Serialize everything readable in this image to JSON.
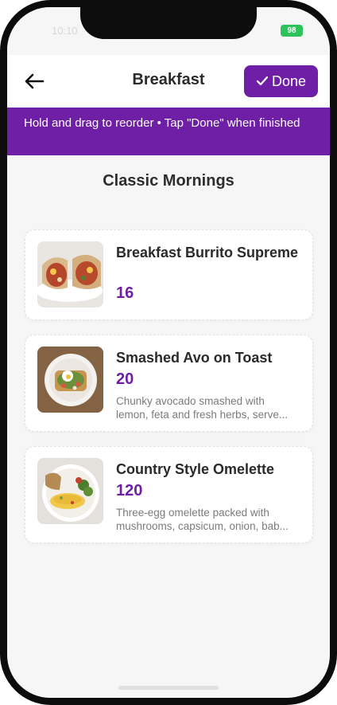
{
  "status_bar": {
    "time": "10:10",
    "battery": "98"
  },
  "header": {
    "title": "Breakfast",
    "done_label": "Done"
  },
  "banner": {
    "text": "Hold and drag to reorder • Tap \"Done\" when finished"
  },
  "section": {
    "title": "Classic Mornings"
  },
  "items": [
    {
      "title": "Breakfast Burrito Supreme",
      "count": "16",
      "description": []
    },
    {
      "title": "Smashed Avo on Toast",
      "count": "20",
      "description": [
        "Chunky avocado smashed with",
        "lemon, feta and fresh herbs, serve..."
      ]
    },
    {
      "title": "Country Style Omelette",
      "count": "120",
      "description": [
        "Three-egg omelette packed with",
        "mushrooms, capsicum, onion, bab..."
      ]
    }
  ],
  "colors": {
    "accent": "#6e1fa6",
    "background": "#f6f6f6"
  },
  "icons": {
    "back": "arrow-left-icon",
    "done": "check-icon"
  }
}
